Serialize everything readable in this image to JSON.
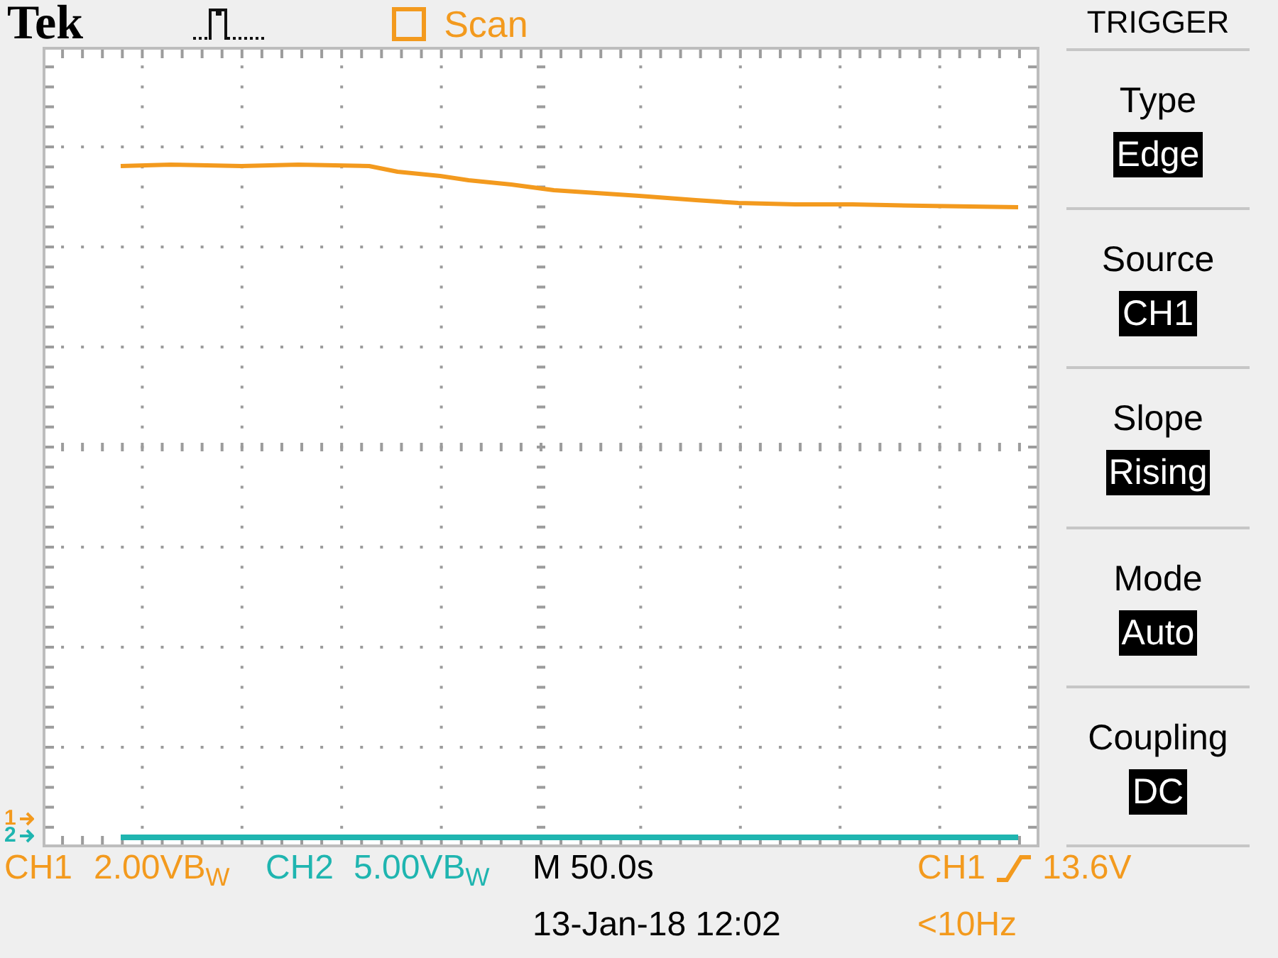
{
  "header": {
    "brand": "Tek",
    "acquisition": {
      "mode": "Scan"
    }
  },
  "display": {
    "channel_markers": [
      {
        "label": "1",
        "color": "#f39a1e"
      },
      {
        "label": "2",
        "color": "#1fb5b0"
      }
    ]
  },
  "trigger_menu": {
    "title": "TRIGGER",
    "items": [
      {
        "label": "Type",
        "value": "Edge"
      },
      {
        "label": "Source",
        "value": "CH1"
      },
      {
        "label": "Slope",
        "value": "Rising"
      },
      {
        "label": "Mode",
        "value": "Auto"
      },
      {
        "label": "Coupling",
        "value": "DC"
      }
    ]
  },
  "status_bar": {
    "channels": [
      {
        "name": "CH1",
        "scale": "2.00VB$_{W}$",
        "color": "#f39a1e"
      },
      {
        "name": "CH2",
        "scale": "5.00VB$_{W}$",
        "color": "#1fb5b0"
      }
    ],
    "timebase": "M 50.0s",
    "date_time": "13-Jan-18 12:02",
    "trigger": {
      "source": "CH1",
      "level": "13.6V",
      "frequency": "<10Hz"
    }
  }
}
